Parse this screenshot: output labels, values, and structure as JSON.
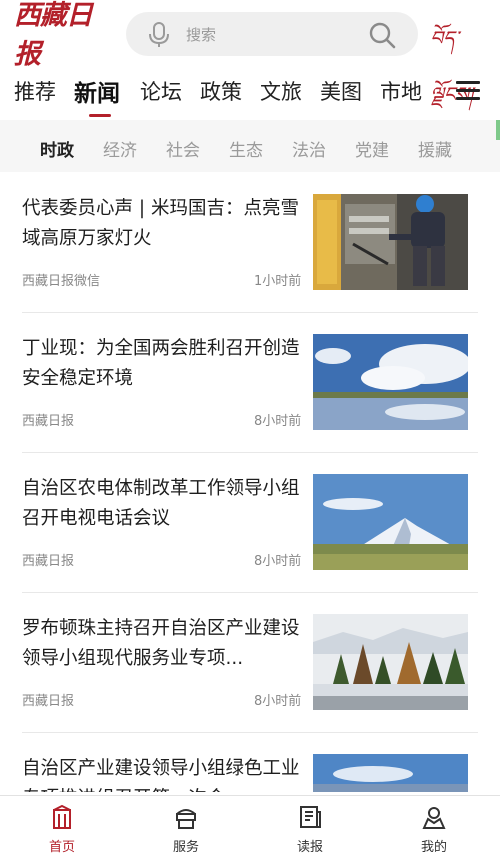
{
  "header": {
    "logo_text": "西藏日报",
    "search_placeholder": "搜索",
    "tibetan_label": "བོད་ལྗོངས།",
    "icons": {
      "mic": "microphone-icon",
      "search": "search-icon",
      "menu": "menu-icon"
    }
  },
  "main_tabs": [
    {
      "label": "推荐"
    },
    {
      "label": "新闻"
    },
    {
      "label": "论坛"
    },
    {
      "label": "政策"
    },
    {
      "label": "文旅"
    },
    {
      "label": "美图"
    },
    {
      "label": "市地"
    }
  ],
  "active_main_tab": "新闻",
  "sub_tabs": [
    {
      "label": "时政"
    },
    {
      "label": "经济"
    },
    {
      "label": "社会"
    },
    {
      "label": "生态"
    },
    {
      "label": "法治"
    },
    {
      "label": "党建"
    },
    {
      "label": "援藏"
    }
  ],
  "active_sub_tab": "时政",
  "articles": [
    {
      "title": "代表委员心声 | 米玛国吉：点亮雪域高原万家灯火",
      "source": "西藏日报微信",
      "time": "1小时前"
    },
    {
      "title": "丁业现：为全国两会胜利召开创造安全稳定环境",
      "source": "西藏日报",
      "time": "8小时前"
    },
    {
      "title": "自治区农电体制改革工作领导小组召开电视电话会议",
      "source": "西藏日报",
      "time": "8小时前"
    },
    {
      "title": "罗布顿珠主持召开自治区产业建设领导小组现代服务业专项...",
      "source": "西藏日报",
      "time": "8小时前"
    },
    {
      "title": "自治区产业建设领导小组绿色工业专项推进组召开第一次会",
      "source": "",
      "time": ""
    }
  ],
  "bottom_nav": [
    {
      "label": "首页",
      "icon": "home-icon"
    },
    {
      "label": "服务",
      "icon": "service-icon"
    },
    {
      "label": "读报",
      "icon": "newspaper-icon"
    },
    {
      "label": "我的",
      "icon": "profile-icon"
    }
  ],
  "colors": {
    "accent": "#b3202a",
    "muted": "#888888",
    "subtab_bg": "#f6f6f6"
  }
}
